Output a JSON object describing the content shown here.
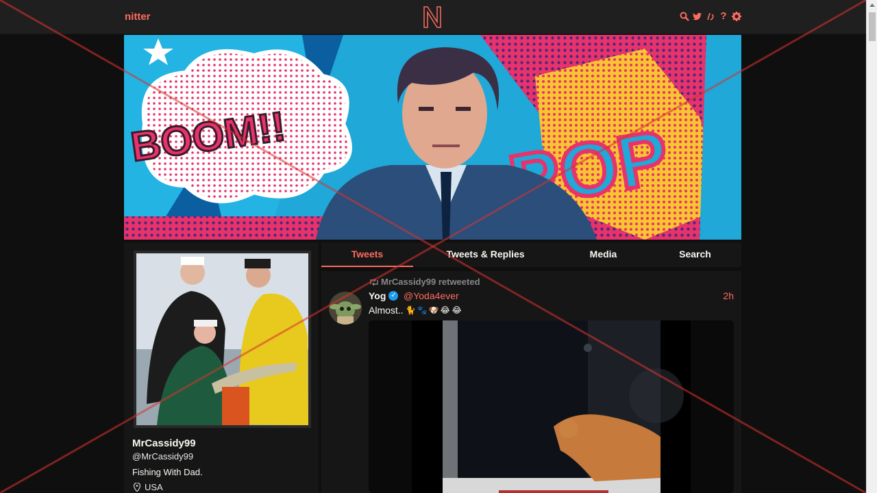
{
  "navbar": {
    "brand": "nitter",
    "logo_letter": "N",
    "icons": [
      "search-icon",
      "bird-icon",
      "rss-icon",
      "help-icon",
      "gear-icon"
    ],
    "help_glyph": "?"
  },
  "banner": {
    "boom_text": "BOOM!!",
    "pop_text": "POP"
  },
  "profile": {
    "fullname": "MrCassidy99",
    "username": "@MrCassidy99",
    "bio": "Fishing With Dad.",
    "location": "USA"
  },
  "tabs": [
    {
      "label": "Tweets",
      "active": true
    },
    {
      "label": "Tweets & Replies",
      "active": false
    },
    {
      "label": "Media",
      "active": false
    },
    {
      "label": "Search",
      "active": false
    }
  ],
  "tweet": {
    "retweet_label": "MrCassidy99 retweeted",
    "name": "Yog",
    "handle": "@Yoda4ever",
    "date": "2h",
    "text": "Almost..",
    "emojis": [
      "🐈",
      "🐾",
      "🐶",
      "😂",
      "😂"
    ]
  },
  "colors": {
    "accent": "#ff6c60",
    "background": "#0f0f0f",
    "panel": "#161616",
    "navbar": "#1f1f1f"
  }
}
